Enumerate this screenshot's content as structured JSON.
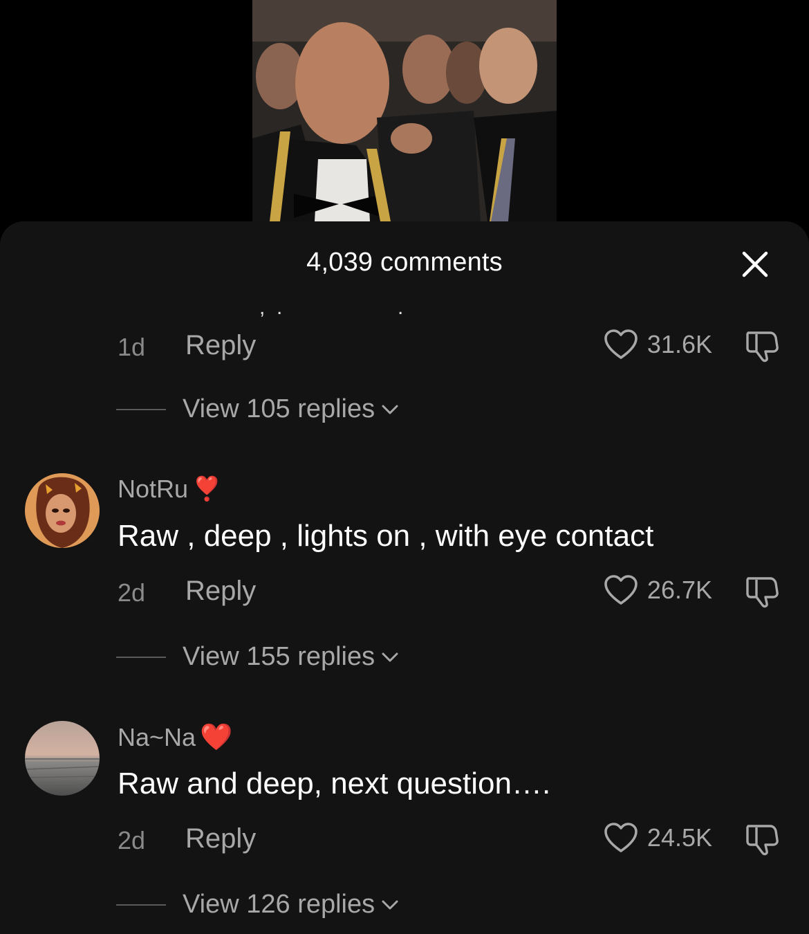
{
  "header": {
    "comment_count_label": "4,039 comments"
  },
  "truncated_previous_comment": ",  .                    .",
  "comments": [
    {
      "time": "1d",
      "reply_label": "Reply",
      "likes": "31.6K",
      "view_replies": "View 105 replies"
    },
    {
      "username": "NotRu",
      "username_emoji": "❣️",
      "text": "Raw , deep , lights on , with eye contact",
      "time": "2d",
      "reply_label": "Reply",
      "likes": "26.7K",
      "view_replies": "View 155 replies"
    },
    {
      "username": "Na~Na",
      "username_emoji": "❤️",
      "text": "Raw and deep, next question….",
      "time": "2d",
      "reply_label": "Reply",
      "likes": "24.5K",
      "view_replies": "View 126 replies"
    }
  ],
  "colors": {
    "sheet_bg": "#131313",
    "secondary_text": "#a8a8a8",
    "primary_text": "#ffffff"
  }
}
